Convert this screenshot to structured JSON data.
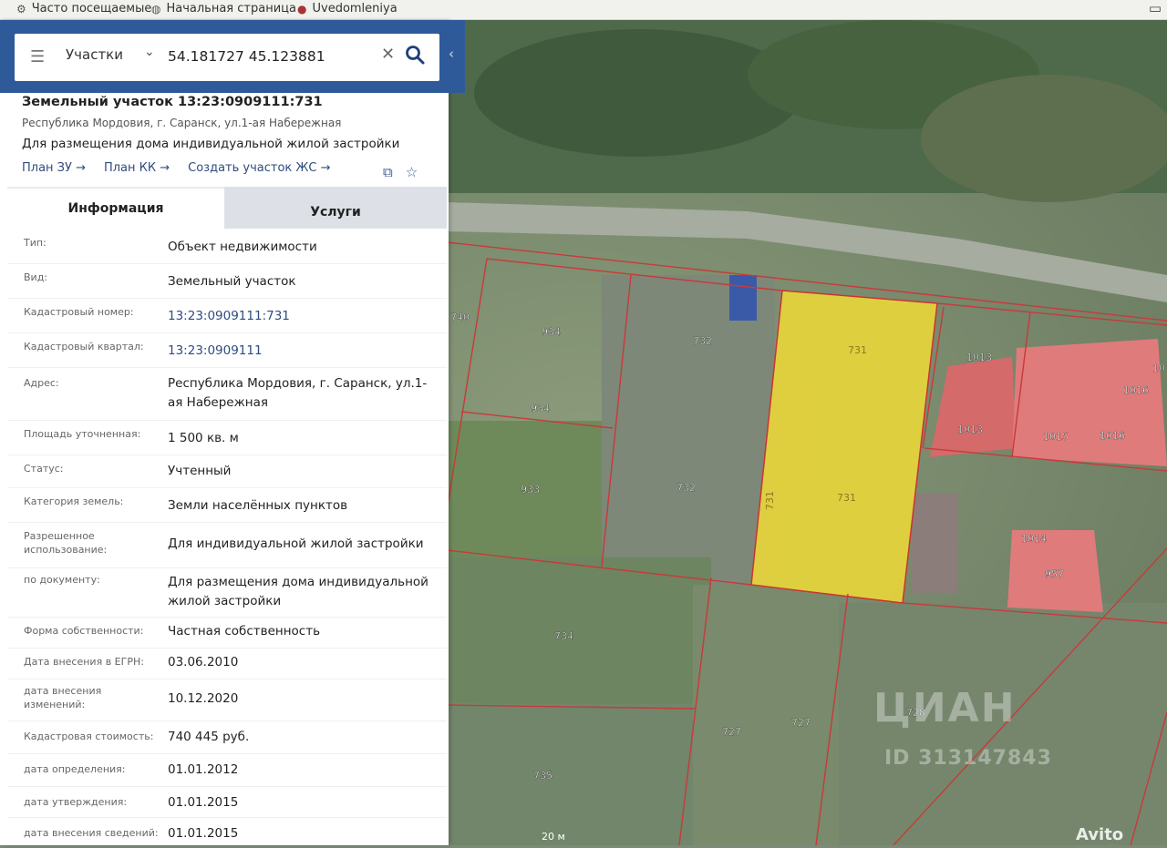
{
  "browser": {
    "bookmarks": [
      {
        "label": "Часто посещаемые",
        "icon": "gear-icon"
      },
      {
        "label": "Начальная страница",
        "icon": "globe-icon"
      },
      {
        "label": "Uvedomleniya",
        "icon": "shield-icon"
      }
    ]
  },
  "search": {
    "layer": "Участки",
    "query": "54.181727 45.123881"
  },
  "parcel": {
    "title": "Земельный участок 13:23:0909111:731",
    "address": "Республика Мордовия, г. Саранск, ул.1-ая Набережная",
    "purpose": "Для размещения дома индивидуальной жилой застройки",
    "actions": [
      "План ЗУ →",
      "План КК →",
      "Создать участок ЖС →"
    ]
  },
  "tabs": [
    "Информация",
    "Услуги"
  ],
  "info_rows": [
    {
      "label": "Тип:",
      "value": "Объект недвижимости"
    },
    {
      "label": "Вид:",
      "value": "Земельный участок"
    },
    {
      "label": "Кадастровый номер:",
      "value": "13:23:0909111:731"
    },
    {
      "label": "Кадастровый квартал:",
      "value": "13:23:0909111"
    },
    {
      "label": "Адрес:",
      "value": "Республика Мордовия, г. Саранск, ул.1-ая Набережная"
    },
    {
      "label": "Площадь уточненная:",
      "value": "1 500 кв. м"
    },
    {
      "label": "Статус:",
      "value": "Учтенный"
    },
    {
      "label": "Категория земель:",
      "value": "Земли населённых пунктов"
    },
    {
      "label": "Разрешенное использование:",
      "value": "Для индивидуальной жилой застройки"
    },
    {
      "label": "по документу:",
      "value": "Для размещения дома индивидуальной жилой застройки"
    },
    {
      "label": "Форма собственности:",
      "value": "Частная собственность"
    },
    {
      "label": "Дата внесения в ЕГРН:",
      "value": "03.06.2010"
    },
    {
      "label": "дата внесения изменений:",
      "value": "10.12.2020"
    },
    {
      "label": "Кадастровая стоимость:",
      "value": "740 445 руб."
    },
    {
      "label": "дата определения:",
      "value": "01.01.2012"
    },
    {
      "label": "дата утверждения:",
      "value": "01.01.2015"
    },
    {
      "label": "дата внесения сведений:",
      "value": "01.01.2015"
    }
  ],
  "map": {
    "parcel_labels": [
      "934",
      "934",
      "933",
      "732",
      "732",
      "731",
      "731",
      "731",
      "1013",
      "1013",
      "1015",
      "1016",
      "1016",
      "1014",
      "957",
      "734",
      "735",
      "727",
      "727",
      "728",
      "740",
      "10"
    ],
    "scale": "20 м",
    "watermark": "ЦИАН",
    "watermark_id": "ID 313147843",
    "avito": "Avito"
  }
}
